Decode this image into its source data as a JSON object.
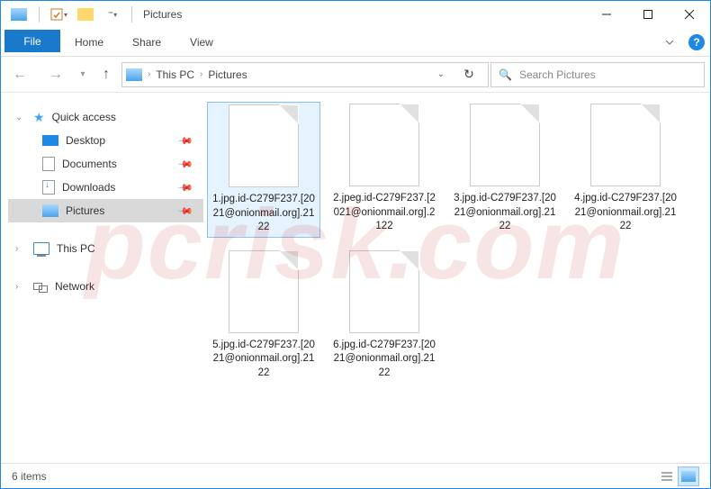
{
  "window": {
    "title": "Pictures"
  },
  "qat": {
    "icon1": "monitor",
    "icon2": "properties",
    "icon3": "folder"
  },
  "win_controls": {
    "min": "minimize",
    "max": "maximize",
    "close": "close"
  },
  "ribbon": {
    "file": "File",
    "tabs": [
      "Home",
      "Share",
      "View"
    ],
    "expand": "v",
    "help": "?"
  },
  "nav": {
    "back": "←",
    "forward": "→",
    "recent": "▾",
    "up": "↑",
    "breadcrumb": [
      "This PC",
      "Pictures"
    ],
    "refresh": "↻",
    "search_placeholder": "Search Pictures"
  },
  "sidebar": {
    "quick": {
      "label": "Quick access"
    },
    "items": [
      {
        "label": "Desktop",
        "icon": "desktop",
        "pinned": true
      },
      {
        "label": "Documents",
        "icon": "doc",
        "pinned": true
      },
      {
        "label": "Downloads",
        "icon": "down",
        "pinned": true
      },
      {
        "label": "Pictures",
        "icon": "pic",
        "pinned": true,
        "selected": true
      }
    ],
    "thispc": {
      "label": "This PC"
    },
    "network": {
      "label": "Network"
    }
  },
  "files": [
    {
      "name": "1.jpg.id-C279F237.[2021@onionmail.org].2122",
      "selected": true
    },
    {
      "name": "2.jpeg.id-C279F237.[2021@onionmail.org].2122"
    },
    {
      "name": "3.jpg.id-C279F237.[2021@onionmail.org].2122"
    },
    {
      "name": "4.jpg.id-C279F237.[2021@onionmail.org].2122"
    },
    {
      "name": "5.jpg.id-C279F237.[2021@onionmail.org].2122"
    },
    {
      "name": "6.jpg.id-C279F237.[2021@onionmail.org].2122"
    }
  ],
  "status": {
    "count": "6 items"
  },
  "view": {
    "details": "details-icon",
    "thumbs": "thumbnails-icon"
  }
}
